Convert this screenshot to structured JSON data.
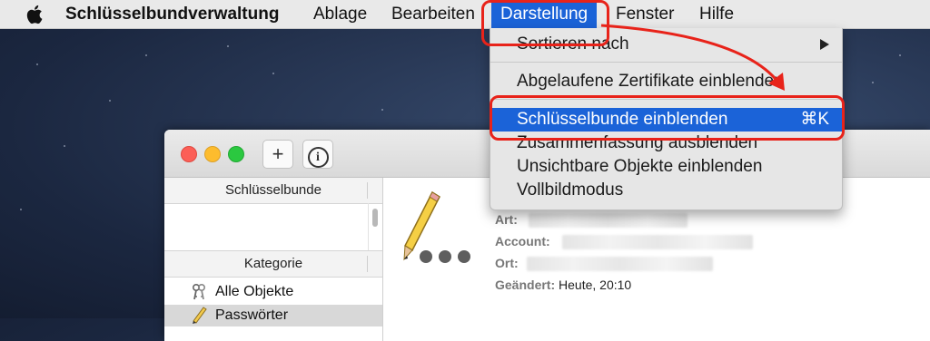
{
  "menubar": {
    "app_name": "Schlüsselbundverwaltung",
    "items": [
      "Ablage",
      "Bearbeiten",
      "Darstellung",
      "Fenster",
      "Hilfe"
    ]
  },
  "menu": {
    "sort": "Sortieren nach",
    "expired_certs": "Abgelaufene Zertifikate einblenden",
    "show_keychains": "Schlüsselbunde einblenden",
    "show_keychains_shortcut": "⌘K",
    "hide_summary": "Zusammenfassung ausblenden",
    "show_invisible": "Unsichtbare Objekte einblenden",
    "fullscreen": "Vollbildmodus"
  },
  "window": {
    "toolbar": {
      "add_label": "+",
      "info_label": "i"
    },
    "keychains_header": "Schlüsselbunde",
    "category_header": "Kategorie",
    "categories": [
      "Alle Objekte",
      "Passwörter"
    ],
    "details": {
      "kind_label": "Art:",
      "account_label": "Account:",
      "where_label": "Ort:",
      "modified_label": "Geändert:",
      "modified_value": "Heute, 20:10"
    }
  },
  "colors": {
    "highlight": "#1b63d8",
    "annotation": "#e8231a"
  }
}
